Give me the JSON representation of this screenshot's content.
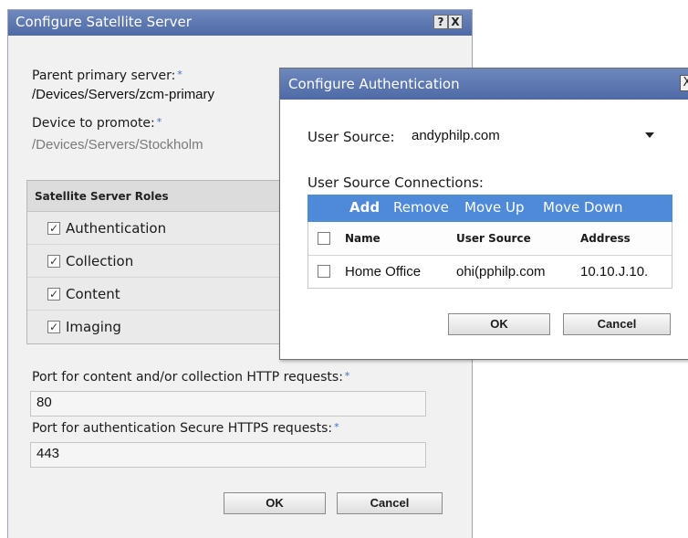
{
  "main_dialog": {
    "title": "Configure Satellite Server",
    "help_label": "?",
    "close_label": "X",
    "parent_label": "Parent primary server:",
    "parent_value": "/Devices/Servers/zcm-primary",
    "device_label": "Device to promote:",
    "device_value": "/Devices/Servers/Stockholm",
    "required_marker": "*",
    "roles_header": "Satellite Server Roles",
    "roles": [
      {
        "label": "Authentication",
        "checked": true
      },
      {
        "label": "Collection",
        "checked": true
      },
      {
        "label": "Content",
        "checked": true
      },
      {
        "label": "Imaging",
        "checked": true
      }
    ],
    "http_port_label": "Port for content and/or collection HTTP requests:",
    "http_port_value": "80",
    "https_port_label": "Port for authentication Secure HTTPS requests:",
    "https_port_value": "443",
    "ok_label": "OK",
    "cancel_label": "Cancel"
  },
  "auth_dialog": {
    "title": "Configure Authentication",
    "close_label": "X",
    "user_source_label": "User Source:",
    "user_source_value": "andyphilp.com",
    "connections_label": "User Source Connections:",
    "toolbar": {
      "add": "Add",
      "remove": "Remove",
      "move_up": "Move Up",
      "move_down": "Move Down"
    },
    "columns": [
      "Name",
      "User Source",
      "Address"
    ],
    "rows": [
      {
        "name": "Home Office",
        "user_source": "ohi(pphilp.com",
        "address": "10.10.J.10."
      }
    ],
    "ok_label": "OK",
    "cancel_label": "Cancel"
  },
  "colors": {
    "title_bar": "#5a76b0",
    "toolbar_blue": "#4f8ad9",
    "required_marker": "#3b6fc6"
  }
}
